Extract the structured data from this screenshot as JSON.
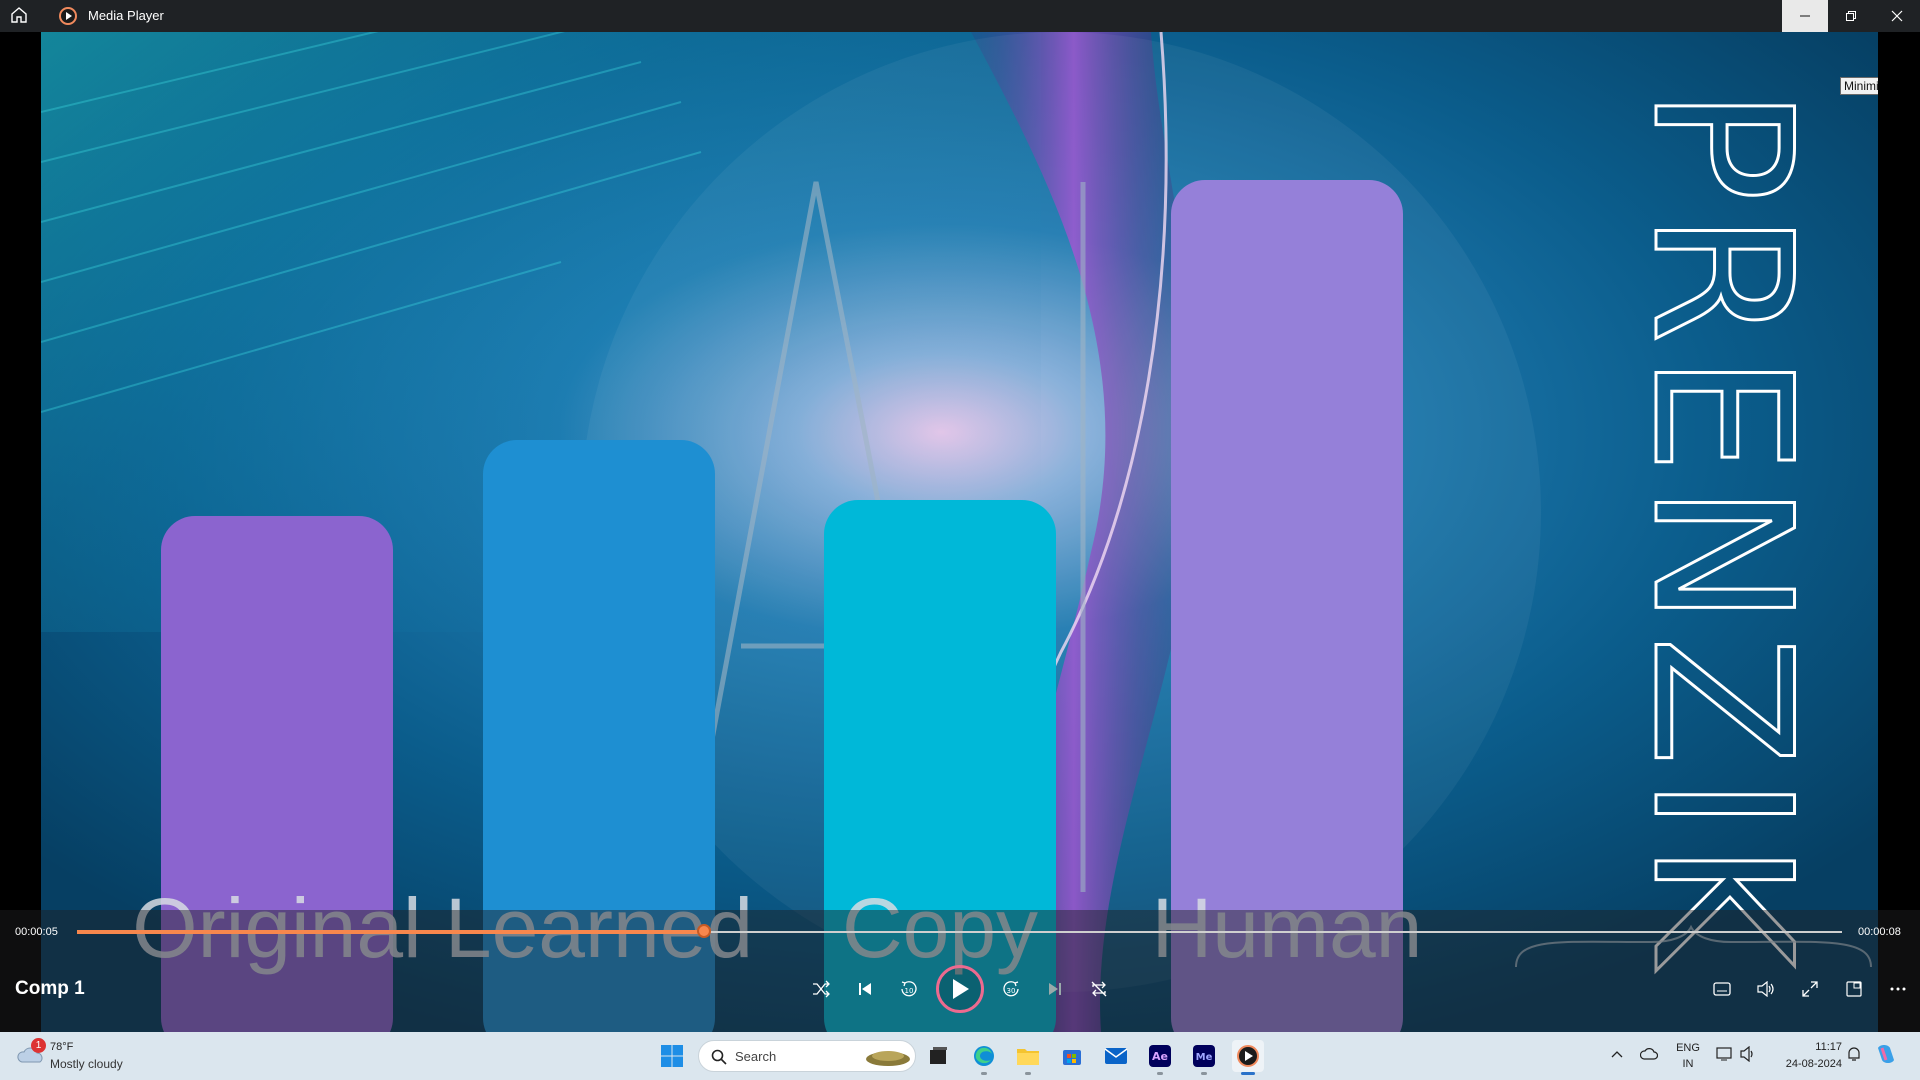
{
  "window": {
    "title": "Media Player",
    "tooltip": "Minimize"
  },
  "video": {
    "bars": [
      {
        "label": "Original",
        "color": "#8b64cf"
      },
      {
        "label": "Learned",
        "color": "#1e8fd2"
      },
      {
        "label": "Copy",
        "color": "#00b8d8"
      },
      {
        "label": "Human",
        "color": "#9580d9"
      }
    ],
    "watermark": "AI",
    "brand_vertical": "PRENZIK"
  },
  "player": {
    "current_time": "00:00:05",
    "total_time": "00:00:08",
    "progress": 0.355,
    "media_title": "Comp 1",
    "accent": "#f7874d"
  },
  "taskbar": {
    "weather": {
      "temp": "78°F",
      "desc": "Mostly cloudy",
      "badge": "1"
    },
    "search_label": "Search",
    "apps": [
      "windows-start-icon",
      "task-view-icon",
      "edge-icon",
      "file-explorer-icon",
      "store-icon",
      "mail-icon",
      "after-effects-icon",
      "media-encoder-icon",
      "media-player-icon"
    ],
    "tray": {
      "lang_top": "ENG",
      "lang_bottom": "IN",
      "time": "11:17",
      "date": "24-08-2024"
    }
  }
}
